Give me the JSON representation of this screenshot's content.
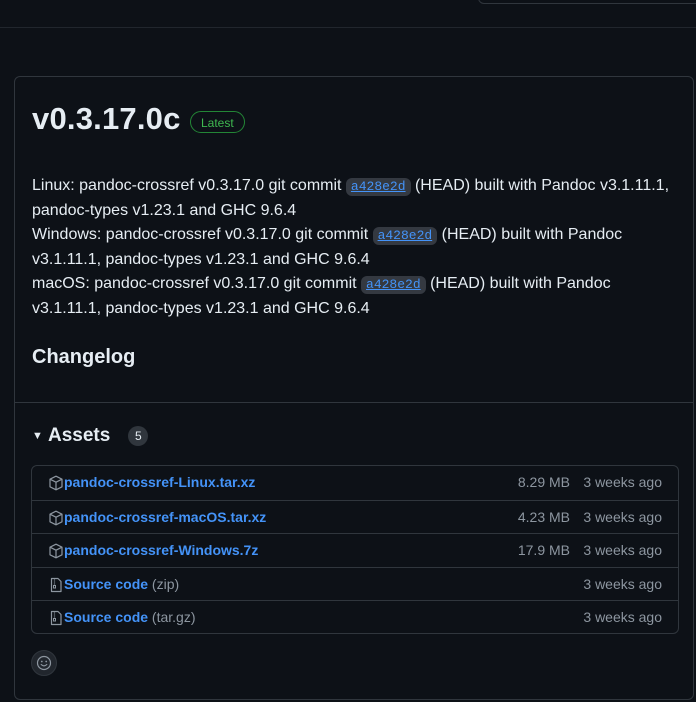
{
  "release": {
    "tag": "v0.3.17.0c",
    "latest_label": "Latest",
    "notes": [
      {
        "prefix": "Linux: pandoc-crossref v0.3.17.0 git commit ",
        "commit": "a428e2d",
        "suffix": " (HEAD) built with Pandoc v3.1.11.1, pandoc-types v1.23.1 and GHC 9.6.4"
      },
      {
        "prefix": "Windows: pandoc-crossref v0.3.17.0 git commit ",
        "commit": "a428e2d",
        "suffix": " (HEAD) built with Pandoc v3.1.11.1, pandoc-types v1.23.1 and GHC 9.6.4"
      },
      {
        "prefix": "macOS: pandoc-crossref v0.3.17.0 git commit ",
        "commit": "a428e2d",
        "suffix": " (HEAD) built with Pandoc v3.1.11.1, pandoc-types v1.23.1 and GHC 9.6.4"
      }
    ],
    "changelog_heading": "Changelog"
  },
  "assets": {
    "title": "Assets",
    "count": "5",
    "items": [
      {
        "name": "pandoc-crossref-Linux.tar.xz",
        "name_suffix": "",
        "size": "8.29 MB",
        "date": "3 weeks ago",
        "icon": "package-icon"
      },
      {
        "name": "pandoc-crossref-macOS.tar.xz",
        "name_suffix": "",
        "size": "4.23 MB",
        "date": "3 weeks ago",
        "icon": "package-icon"
      },
      {
        "name": "pandoc-crossref-Windows.7z",
        "name_suffix": "",
        "size": "17.9 MB",
        "date": "3 weeks ago",
        "icon": "package-icon"
      },
      {
        "name": "Source code",
        "name_suffix": "(zip)",
        "size": "",
        "date": "3 weeks ago",
        "icon": "file-zip-icon"
      },
      {
        "name": "Source code",
        "name_suffix": "(tar.gz)",
        "size": "",
        "date": "3 weeks ago",
        "icon": "file-zip-icon"
      }
    ]
  },
  "colors": {
    "background": "#0d1117",
    "border": "#30363d",
    "link": "#4493f8",
    "latest_green": "#3fb950",
    "muted": "#8d96a0"
  }
}
